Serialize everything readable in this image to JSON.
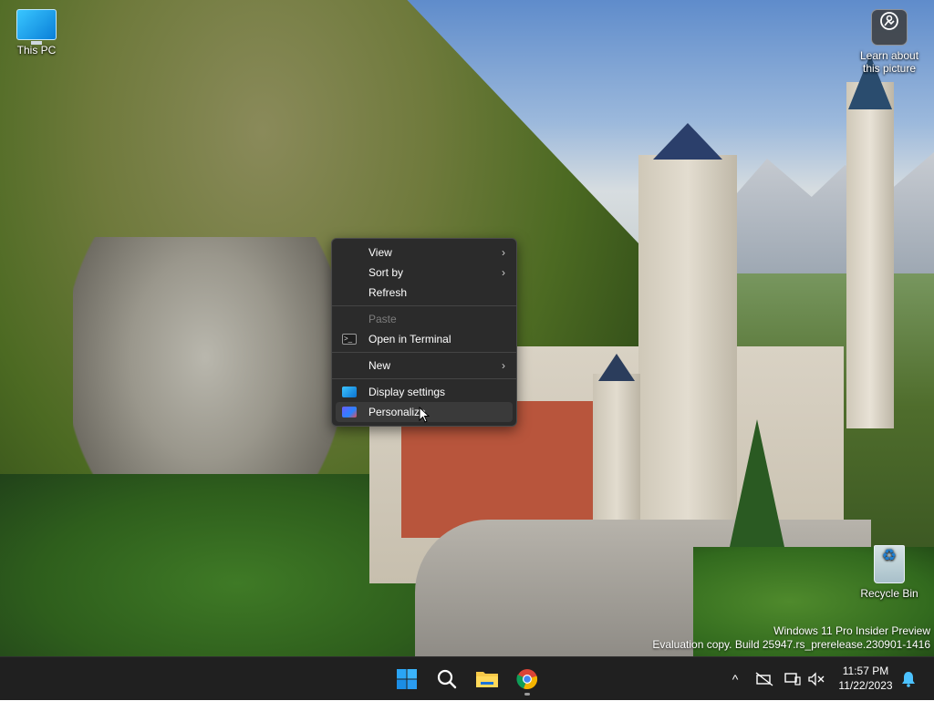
{
  "desktop": {
    "icons": [
      {
        "label": "This PC"
      },
      {
        "label": "Learn about this picture"
      },
      {
        "label": "Recycle Bin"
      }
    ],
    "watermark": {
      "line1": "Windows 11 Pro Insider Preview",
      "line2": "Evaluation copy. Build 25947.rs_prerelease.230901-1416"
    }
  },
  "context_menu": {
    "items": [
      {
        "label": "View",
        "has_submenu": true,
        "enabled": true
      },
      {
        "label": "Sort by",
        "has_submenu": true,
        "enabled": true
      },
      {
        "label": "Refresh",
        "has_submenu": false,
        "enabled": true
      },
      {
        "label": "Paste",
        "has_submenu": false,
        "enabled": false
      },
      {
        "label": "Open in Terminal",
        "has_submenu": false,
        "enabled": true,
        "icon": "terminal-icon"
      },
      {
        "label": "New",
        "has_submenu": true,
        "enabled": true
      },
      {
        "label": "Display settings",
        "has_submenu": false,
        "enabled": true,
        "icon": "display-settings-icon"
      },
      {
        "label": "Personalize",
        "has_submenu": false,
        "enabled": true,
        "icon": "personalize-icon",
        "hovered": true
      }
    ],
    "chevron": "›"
  },
  "taskbar": {
    "apps": [
      "start-icon",
      "search-icon",
      "file-explorer-icon",
      "chrome-icon"
    ],
    "clock": {
      "time": "11:57 PM",
      "date": "11/22/2023"
    },
    "tray_chevron": "^"
  },
  "colors": {
    "taskbar_bg": "#202020",
    "menu_bg": "#2b2b2b",
    "accent": "#0078d4"
  }
}
